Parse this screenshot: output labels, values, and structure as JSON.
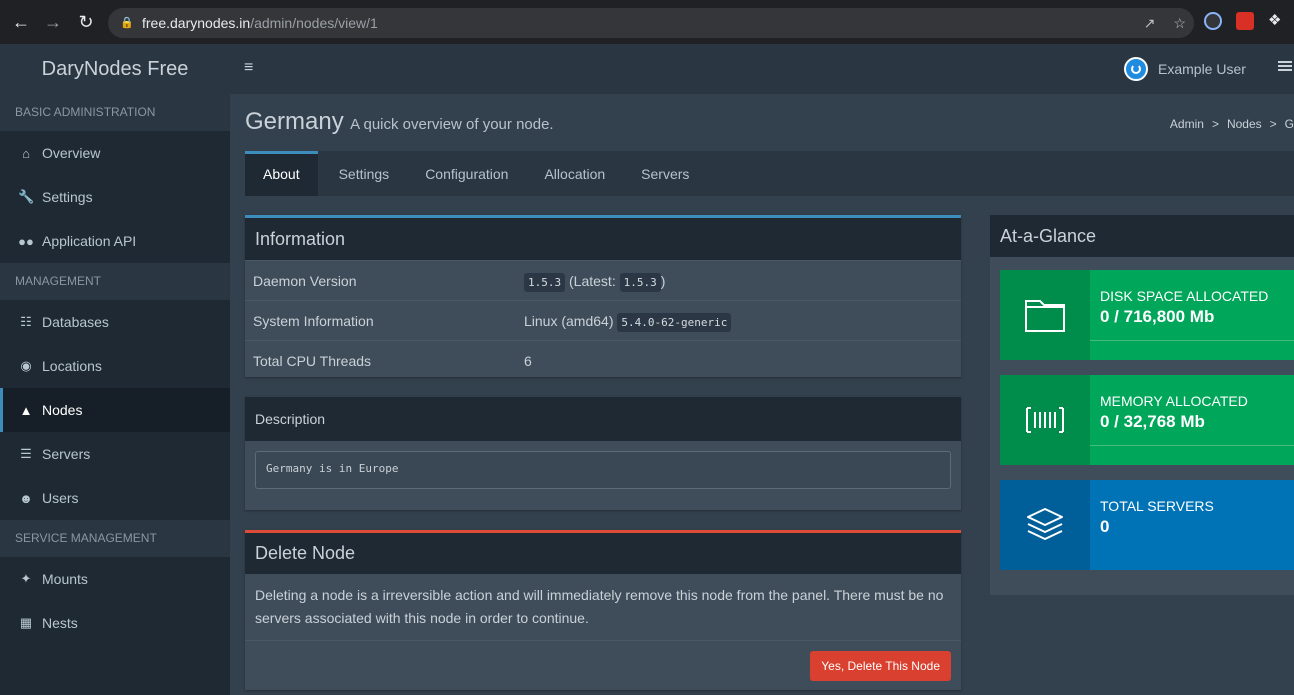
{
  "browser": {
    "url_domain": "free.darynodes.in",
    "url_path": "/admin/nodes/view/1"
  },
  "header": {
    "brand": "DaryNodes Free",
    "user_name": "Example User"
  },
  "sidebar": {
    "sections": [
      {
        "title": "BASIC ADMINISTRATION",
        "items": [
          {
            "label": "Overview",
            "icon": "home-icon"
          },
          {
            "label": "Settings",
            "icon": "wrench-icon"
          },
          {
            "label": "Application API",
            "icon": "gamepad-icon"
          }
        ]
      },
      {
        "title": "MANAGEMENT",
        "items": [
          {
            "label": "Databases",
            "icon": "database-icon"
          },
          {
            "label": "Locations",
            "icon": "globe-icon"
          },
          {
            "label": "Nodes",
            "icon": "sitemap-icon",
            "active": true
          },
          {
            "label": "Servers",
            "icon": "server-icon"
          },
          {
            "label": "Users",
            "icon": "users-icon"
          }
        ]
      },
      {
        "title": "SERVICE MANAGEMENT",
        "items": [
          {
            "label": "Mounts",
            "icon": "magic-icon"
          },
          {
            "label": "Nests",
            "icon": "grid-icon"
          }
        ]
      }
    ]
  },
  "page": {
    "title": "Germany",
    "subtitle": "A quick overview of your node.",
    "breadcrumb": [
      "Admin",
      ">",
      "Nodes",
      ">",
      "G"
    ]
  },
  "tabs": [
    "About",
    "Settings",
    "Configuration",
    "Allocation",
    "Servers"
  ],
  "information": {
    "title": "Information",
    "rows": [
      {
        "key": "Daemon Version",
        "code1": "1.5.3",
        "mid": "(Latest:",
        "code2": "1.5.3",
        "end": ")"
      },
      {
        "key": "System Information",
        "text": "Linux (amd64)",
        "code1": "5.4.0-62-generic"
      },
      {
        "key": "Total CPU Threads",
        "text": "6"
      }
    ]
  },
  "description": {
    "title": "Description",
    "value": "Germany is in Europe"
  },
  "delete_node": {
    "title": "Delete Node",
    "text": "Deleting a node is a irreversible action and will immediately remove this node from the panel. There must be no servers associated with this node in order to continue.",
    "button": "Yes, Delete This Node"
  },
  "glance": {
    "title": "At-a-Glance",
    "stats": [
      {
        "label": "DISK SPACE ALLOCATED",
        "value": "0 / 716,800 Mb",
        "color": "#00a65a",
        "icon_bg": "#008d4c",
        "icon": "folder-icon"
      },
      {
        "label": "MEMORY ALLOCATED",
        "value": "0 / 32,768 Mb",
        "color": "#00a65a",
        "icon_bg": "#008d4c",
        "icon": "barcode-icon"
      },
      {
        "label": "TOTAL SERVERS",
        "value": "0",
        "color": "#0073b7",
        "icon_bg": "#005f99",
        "icon": "layers-icon"
      }
    ]
  }
}
